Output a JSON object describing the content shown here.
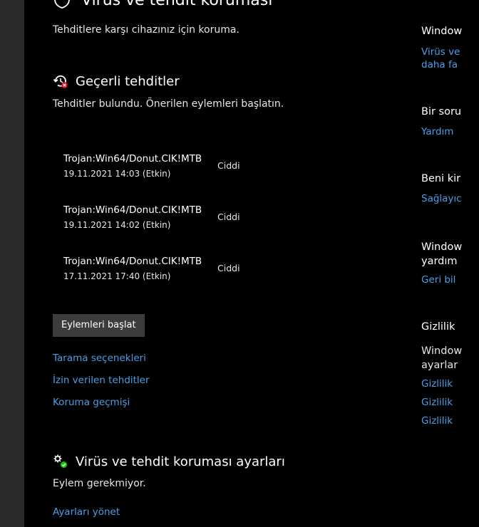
{
  "page": {
    "title": "Virüs ve tehdit koruması",
    "subtitle": "Tehditlere karşı cihazınız için koruma."
  },
  "current_threats": {
    "heading": "Geçerli tehditler",
    "description": "Tehditler bulundu. Önerilen eylemleri başlatın.",
    "items": [
      {
        "name": "Trojan:Win64/Donut.CIK!MTB",
        "date": "19.11.2021 14:03 (Etkin)",
        "severity": "Ciddi"
      },
      {
        "name": "Trojan:Win64/Donut.CIK!MTB",
        "date": "19.11.2021 14:02 (Etkin)",
        "severity": "Ciddi"
      },
      {
        "name": "Trojan:Win64/Donut.CIK!MTB",
        "date": "17.11.2021 17:40 (Etkin)",
        "severity": "Ciddi"
      }
    ],
    "start_actions_label": "Eylemleri başlat",
    "links": [
      "Tarama seçenekleri",
      "İzin verilen tehditler",
      "Koruma geçmişi"
    ]
  },
  "settings": {
    "heading": "Virüs ve tehdit koruması ayarları",
    "description": "Eylem gerekmiyor.",
    "manage_link": "Ayarları yönet"
  },
  "right_panel": {
    "windows_community_heading": "Window",
    "windows_community_link_line1": "Virüs ve",
    "windows_community_link_line2": "daha fa",
    "question_heading": "Bir soru",
    "help_link": "Yardım",
    "feedback_heading": "Beni kir",
    "feedback_link": "Sağlayıc",
    "security_heading_line1": "Window",
    "security_heading_line2": "yardım",
    "security_link": "Geri bil",
    "privacy_heading": "Gizlilik",
    "privacy_text_line1": "Window",
    "privacy_text_line2": "ayarlar",
    "privacy_links": [
      "Gizlilik",
      "Gizlilik",
      "Gizlilik"
    ]
  },
  "colors": {
    "background": "#000000",
    "sidebar": "#2b2b2b",
    "link": "#4a9fe8",
    "button": "#3c3c3c",
    "threat_icon_badge": "#e81123",
    "settings_icon_badge": "#16c60c"
  }
}
